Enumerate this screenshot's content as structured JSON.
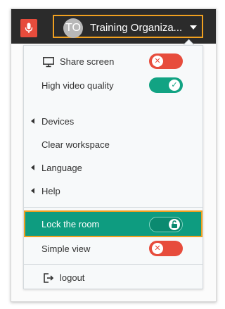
{
  "topbar": {
    "mic_icon": "microphone-icon",
    "avatar_initials": "TO",
    "user_name": "Training Organiza...",
    "dropdown_icon": "caret-down-icon"
  },
  "menu": {
    "share_screen": {
      "label": "Share screen",
      "icon": "monitor-icon",
      "toggle": "off"
    },
    "high_video": {
      "label": "High video quality",
      "toggle": "on"
    },
    "devices": {
      "label": "Devices",
      "icon": "caret-left-icon"
    },
    "clear_workspace": {
      "label": "Clear workspace"
    },
    "language": {
      "label": "Language",
      "icon": "caret-left-icon"
    },
    "help": {
      "label": "Help",
      "icon": "caret-left-icon"
    },
    "lock_room": {
      "label": "Lock the room",
      "toggle": "unlocked",
      "icon": "unlock-icon"
    },
    "simple_view": {
      "label": "Simple view",
      "toggle": "off"
    },
    "logout": {
      "label": "logout",
      "icon": "logout-icon"
    }
  },
  "colors": {
    "topbar_bg": "#2b2b2b",
    "accent_orange": "#f0a020",
    "toggle_off": "#e74c3c",
    "toggle_on": "#12a383",
    "highlight_bg": "#0e9c80"
  }
}
